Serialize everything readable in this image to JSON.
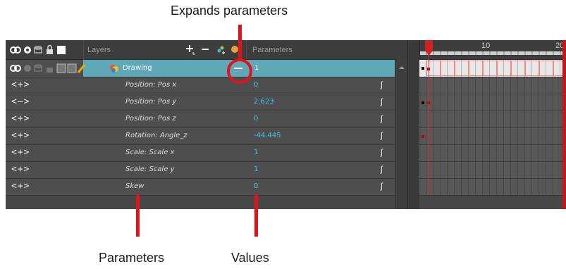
{
  "callouts": {
    "expands": "Expands parameters",
    "parameters": "Parameters",
    "values": "Values"
  },
  "header": {
    "layers_label": "Layers",
    "parameters_label": "Parameters",
    "frame_10": "10",
    "frame_20": "20"
  },
  "layer": {
    "name": "Drawing",
    "value": "1"
  },
  "rows": [
    {
      "nav": "<+>",
      "name": "Position: Pos x",
      "value": "0"
    },
    {
      "nav": "<–>",
      "name": "Position: Pos y",
      "value": "2.623"
    },
    {
      "nav": "<+>",
      "name": "Position: Pos z",
      "value": "0"
    },
    {
      "nav": "<+>",
      "name": "Rotation: Angle_z",
      "value": "-44.445"
    },
    {
      "nav": "<+>",
      "name": "Scale: Scale x",
      "value": "1"
    },
    {
      "nav": "<+>",
      "name": "Scale: Scale y",
      "value": "1"
    },
    {
      "nav": "<+>",
      "name": "Skew",
      "value": "0"
    }
  ],
  "colors": {
    "accent": "#5fa8b8",
    "value_text": "#41c8e8",
    "callout_red": "#e0121a"
  }
}
